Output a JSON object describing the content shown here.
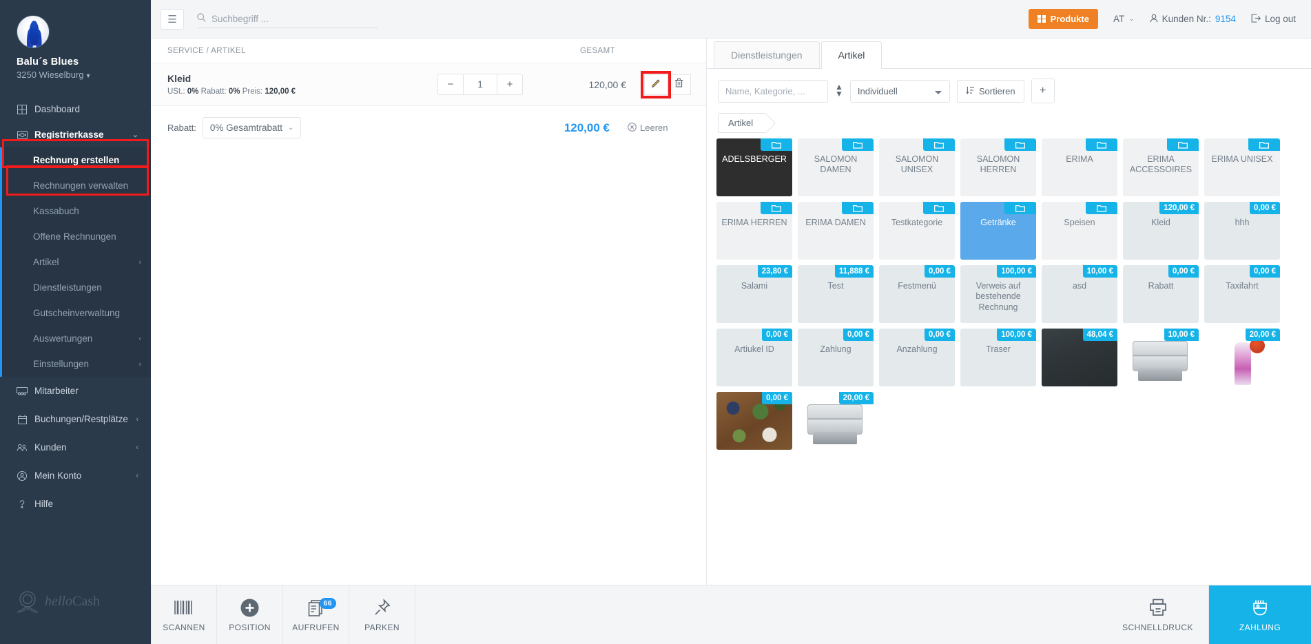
{
  "sidebar": {
    "brand_name": "Balu´s Blues",
    "brand_location": "3250 Wieselburg",
    "items": [
      {
        "label": "Dashboard",
        "icon": "dashboard-icon"
      },
      {
        "label": "Registrierkasse",
        "icon": "cash-register-icon"
      }
    ],
    "submenu": [
      {
        "label": "Rechnung erstellen"
      },
      {
        "label": "Rechnungen verwalten"
      },
      {
        "label": "Kassabuch"
      },
      {
        "label": "Offene Rechnungen"
      },
      {
        "label": "Artikel",
        "arrow": "‹"
      },
      {
        "label": "Dienstleistungen"
      },
      {
        "label": "Gutscheinverwaltung"
      },
      {
        "label": "Auswertungen",
        "arrow": "‹"
      },
      {
        "label": "Einstellungen",
        "arrow": "‹"
      }
    ],
    "lower_items": [
      {
        "label": "Mitarbeiter",
        "icon": "employees-icon",
        "arrow": ""
      },
      {
        "label": "Buchungen/Restplätze",
        "icon": "calendar-icon",
        "arrow": "‹"
      },
      {
        "label": "Kunden",
        "icon": "customers-icon",
        "arrow": "‹"
      },
      {
        "label": "Mein Konto",
        "icon": "account-icon",
        "arrow": "‹"
      },
      {
        "label": "Hilfe",
        "icon": "help-icon",
        "arrow": ""
      }
    ],
    "logo_text_italic": "hello",
    "logo_text": "Cash"
  },
  "topbar": {
    "search_placeholder": "Suchbegriff ...",
    "search_value": "",
    "produkte_label": "Produkte",
    "country_label": "AT",
    "customer_label": "Kunden Nr.:",
    "customer_number": "9154",
    "logout_label": "Log out",
    "accent_orange": "#ef8023",
    "accent_blue": "#2196f3"
  },
  "cart": {
    "col_service": "SERVICE / ARTIKEL",
    "col_gesamt": "GESAMT",
    "item": {
      "name": "Kleid",
      "meta_ust_label": "USt.:",
      "meta_ust_value": "0%",
      "meta_rabatt_label": "Rabatt:",
      "meta_rabatt_value": "0%",
      "meta_preis_label": "Preis:",
      "meta_preis_value": "120,00 €",
      "qty": "1",
      "minus": "−",
      "plus": "+",
      "total": "120,00 €"
    },
    "rabatt_label": "Rabatt:",
    "rabatt_value": "0% Gesamtrabatt",
    "grand_total": "120,00 €",
    "leeren_label": "Leeren"
  },
  "products": {
    "tabs": [
      {
        "label": "Dienstleistungen",
        "active": false
      },
      {
        "label": "Artikel",
        "active": true
      }
    ],
    "filter_placeholder": "Name, Kategorie, ...",
    "filter_value": "",
    "select_value": "Individuell",
    "sort_label": "Sortieren",
    "add_label": "+",
    "breadcrumb": "Artikel",
    "tiles": [
      {
        "name": "ADELSBERGER",
        "kind": "folder",
        "badge": "",
        "style": "dark"
      },
      {
        "name": "SALOMON DAMEN",
        "kind": "folder",
        "badge": "",
        "style": "cat"
      },
      {
        "name": "SALOMON UNISEX",
        "kind": "folder",
        "badge": "",
        "style": "cat"
      },
      {
        "name": "SALOMON HERREN",
        "kind": "folder",
        "badge": "",
        "style": "cat"
      },
      {
        "name": "ERIMA",
        "kind": "folder",
        "badge": "",
        "style": "cat"
      },
      {
        "name": "ERIMA ACCESSOIRES",
        "kind": "folder",
        "badge": "",
        "style": "cat"
      },
      {
        "name": "ERIMA UNISEX",
        "kind": "folder",
        "badge": "",
        "style": "cat"
      },
      {
        "name": "ERIMA HERREN",
        "kind": "folder",
        "badge": "",
        "style": "cat"
      },
      {
        "name": "ERIMA DAMEN",
        "kind": "folder",
        "badge": "",
        "style": "cat"
      },
      {
        "name": "Testkategorie",
        "kind": "folder",
        "badge": "",
        "style": "cat"
      },
      {
        "name": "Getränke",
        "kind": "folder",
        "badge": "",
        "style": "sel"
      },
      {
        "name": "Speisen",
        "kind": "folder",
        "badge": "",
        "style": "cat"
      },
      {
        "name": "Kleid",
        "kind": "price",
        "badge": "120,00 €",
        "style": "art"
      },
      {
        "name": "hhh",
        "kind": "price",
        "badge": "0,00 €",
        "style": "art"
      },
      {
        "name": "Salami",
        "kind": "price",
        "badge": "23,80 €",
        "style": "art"
      },
      {
        "name": "Test",
        "kind": "price",
        "badge": "11,888 €",
        "style": "art"
      },
      {
        "name": "Festmenü",
        "kind": "price",
        "badge": "0,00 €",
        "style": "art"
      },
      {
        "name": "Verweis auf bestehende Rechnung",
        "kind": "price",
        "badge": "100,00 €",
        "style": "art"
      },
      {
        "name": "asd",
        "kind": "price",
        "badge": "10,00 €",
        "style": "art"
      },
      {
        "name": "Rabatt",
        "kind": "price",
        "badge": "0,00 €",
        "style": "art"
      },
      {
        "name": "Taxifahrt",
        "kind": "price",
        "badge": "0,00 €",
        "style": "art"
      },
      {
        "name": "Artiukel ID",
        "kind": "price",
        "badge": "0,00 €",
        "style": "art"
      },
      {
        "name": "Zahlung",
        "kind": "price",
        "badge": "0,00 €",
        "style": "art"
      },
      {
        "name": "Anzahlung",
        "kind": "price",
        "badge": "0,00 €",
        "style": "art"
      },
      {
        "name": "Traser",
        "kind": "price",
        "badge": "100,00 €",
        "style": "art"
      },
      {
        "name": "",
        "kind": "image",
        "badge": "48,04 €",
        "style": "ph-fabric"
      },
      {
        "name": "",
        "kind": "image",
        "badge": "10,00 €",
        "style": "ph-toaster"
      },
      {
        "name": "",
        "kind": "image",
        "badge": "20,00 €",
        "style": "ph-bottle"
      },
      {
        "name": "",
        "kind": "image",
        "badge": "0,00 €",
        "style": "ph-spices"
      },
      {
        "name": "",
        "kind": "image",
        "badge": "20,00 €",
        "style": "ph-toaster"
      }
    ]
  },
  "bottombar": {
    "buttons": [
      {
        "label": "SCANNEN",
        "icon": "barcode-icon",
        "badge": ""
      },
      {
        "label": "POSITION",
        "icon": "plus-circle-icon",
        "badge": ""
      },
      {
        "label": "AUFRUFEN",
        "icon": "documents-icon",
        "badge": "66"
      },
      {
        "label": "PARKEN",
        "icon": "pin-icon",
        "badge": ""
      }
    ],
    "print_label": "SCHNELLDRUCK",
    "pay_label": "ZAHLUNG",
    "pay_color": "#16b3e8"
  }
}
